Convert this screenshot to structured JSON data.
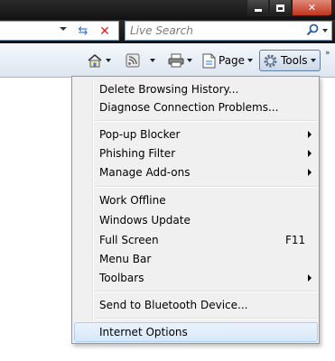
{
  "search": {
    "placeholder": "Live Search"
  },
  "commandbar": {
    "page_label": "Page",
    "tools_label": "Tools"
  },
  "menu": {
    "items": [
      {
        "label": "Delete Browsing History...",
        "shortcut": "",
        "submenu": false
      },
      {
        "label": "Diagnose Connection Problems...",
        "shortcut": "",
        "submenu": false
      },
      {
        "label": "Pop-up Blocker",
        "shortcut": "",
        "submenu": true
      },
      {
        "label": "Phishing Filter",
        "shortcut": "",
        "submenu": true
      },
      {
        "label": "Manage Add-ons",
        "shortcut": "",
        "submenu": true
      },
      {
        "label": "Work Offline",
        "shortcut": "",
        "submenu": false
      },
      {
        "label": "Windows Update",
        "shortcut": "",
        "submenu": false
      },
      {
        "label": "Full Screen",
        "shortcut": "F11",
        "submenu": false
      },
      {
        "label": "Menu Bar",
        "shortcut": "",
        "submenu": false
      },
      {
        "label": "Toolbars",
        "shortcut": "",
        "submenu": true
      },
      {
        "label": "Send to Bluetooth Device...",
        "shortcut": "",
        "submenu": false
      },
      {
        "label": "Internet Options",
        "shortcut": "",
        "submenu": false,
        "highlighted": true
      }
    ]
  },
  "icons": {
    "home": "home-icon",
    "feeds": "feeds-icon",
    "print": "print-icon",
    "page": "page-icon",
    "tools": "gear-icon",
    "refresh": "refresh-icon",
    "stop": "stop-icon",
    "search": "search-icon"
  },
  "colors": {
    "menu_bg": "#f0f0f0",
    "highlight_bg": "#d7e8fb",
    "highlight_border": "#aecff7",
    "close_btn": "#c2341c"
  }
}
